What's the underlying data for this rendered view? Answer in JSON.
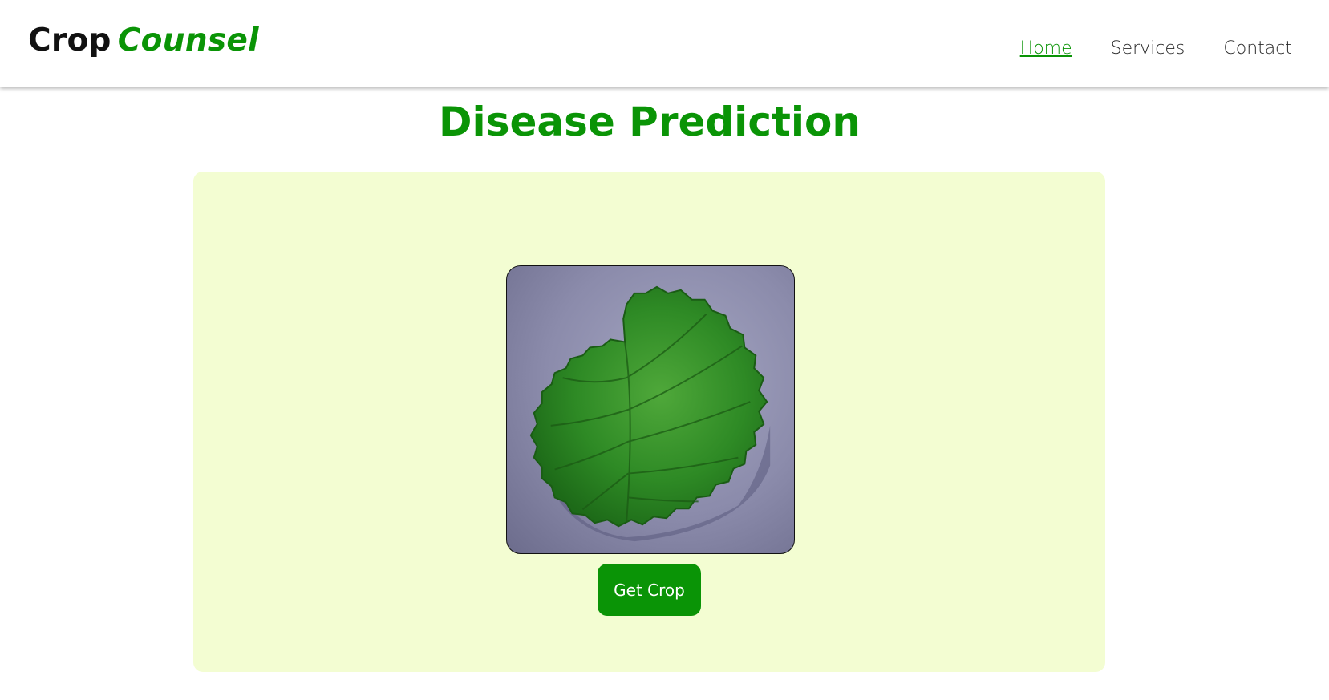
{
  "brand": {
    "name": "Crop",
    "accent": "Counsel"
  },
  "nav": {
    "items": [
      {
        "label": "Home",
        "active": true
      },
      {
        "label": "Services",
        "active": false
      },
      {
        "label": "Contact",
        "active": false
      }
    ]
  },
  "page": {
    "title": "Disease Prediction"
  },
  "upload": {
    "image_subject": "strawberry leaf",
    "button_label": "Get Crop"
  },
  "colors": {
    "accent": "#0a9406",
    "panel_bg": "#f3fdd2",
    "text_dark": "#111111"
  }
}
